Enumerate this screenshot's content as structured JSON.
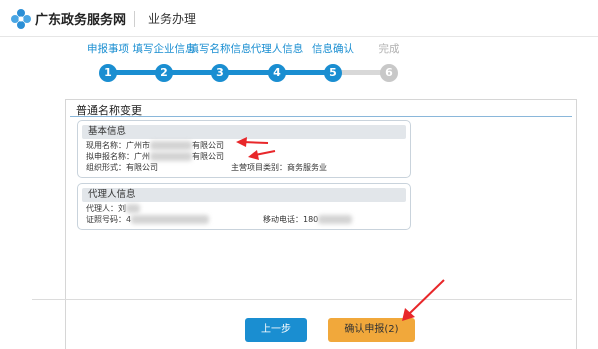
{
  "header": {
    "brand": "广东政务服务网",
    "section": "业务办理"
  },
  "steps": [
    {
      "label": "申报事项",
      "num": "1"
    },
    {
      "label": "填写企业信息",
      "num": "2"
    },
    {
      "label": "填写名称信息",
      "num": "3"
    },
    {
      "label": "代理人信息",
      "num": "4"
    },
    {
      "label": "信息确认",
      "num": "5"
    },
    {
      "label": "完成",
      "num": "6"
    }
  ],
  "panel": {
    "title": "普通名称变更",
    "basic": {
      "title": "基本信息",
      "current_name_label": "现用名称：",
      "current_name_prefix": "广州市",
      "current_name_suffix": "有限公司",
      "proposed_name_label": "拟申报名称：",
      "proposed_name_prefix": "广州",
      "proposed_name_suffix": "有限公司",
      "org_form_label": "组织形式：",
      "org_form_value": "有限公司",
      "industry_label": "主营项目类别：",
      "industry_value": "商务服务业"
    },
    "agent": {
      "title": "代理人信息",
      "agent_label": "代理人：",
      "agent_value": "刘",
      "id_label": "证照号码：",
      "id_value": "4",
      "phone_label": "移动电话：",
      "phone_value": "180"
    }
  },
  "buttons": {
    "prev": "上一步",
    "confirm": "确认申报(2)"
  },
  "colors": {
    "accent": "#1a8ed1",
    "confirm": "#f1a83b",
    "annotation_arrow": "#e8272a"
  },
  "icons": {
    "logo": "gd-gov-logo-icon"
  }
}
